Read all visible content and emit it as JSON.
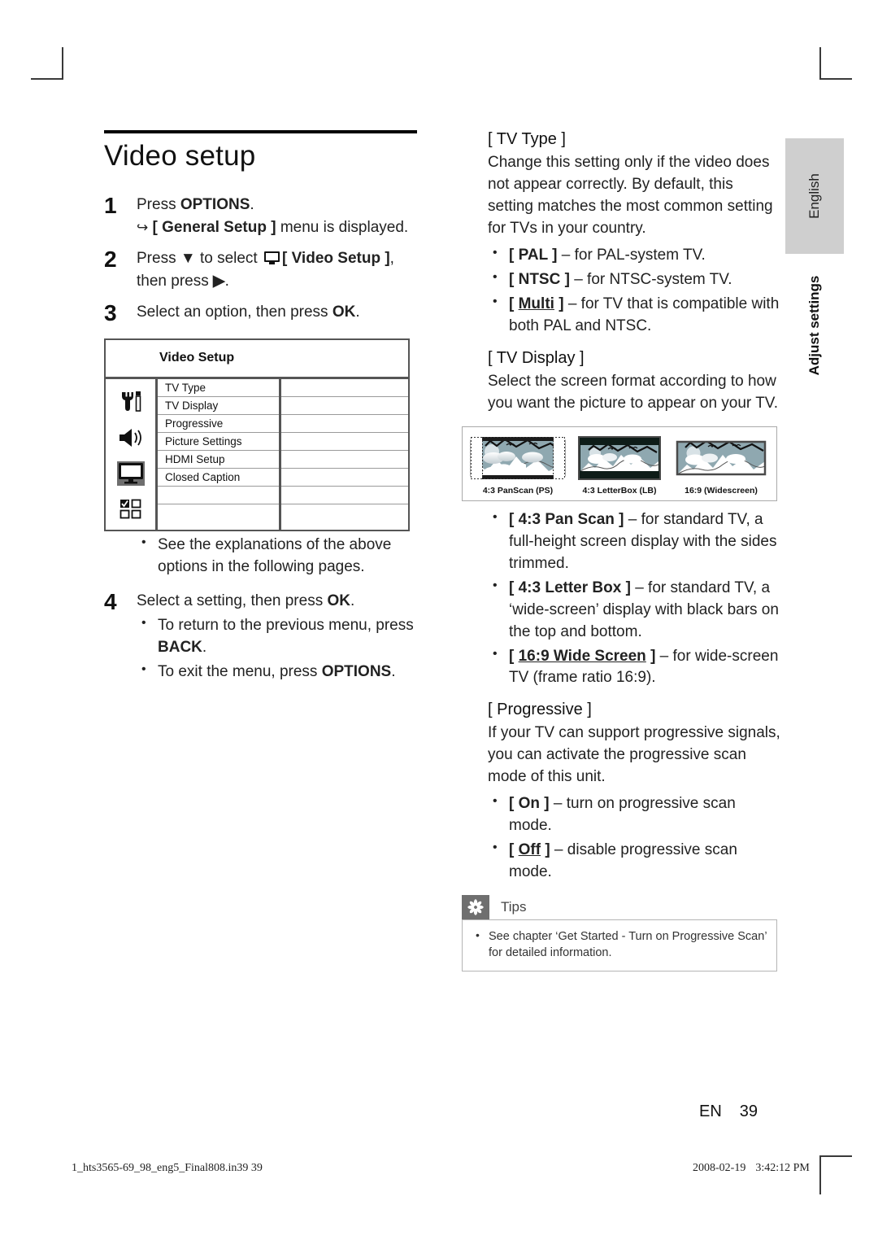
{
  "page": {
    "title": "Video setup",
    "folio_lang": "EN",
    "folio_number": "39",
    "imprint_file": "1_hts3565-69_98_eng5_Final808.in39   39",
    "imprint_date": "2008-02-19",
    "imprint_time": "3:42:12 PM"
  },
  "side_tab": {
    "language": "English",
    "section": "Adjust settings"
  },
  "steps": [
    {
      "num": "1",
      "text": "Press OPTIONS.",
      "lead": "Press ",
      "bold": "OPTIONS",
      "tail": ".",
      "result": "[ General Setup ] menu is displayed.",
      "result_bold": "[ General Setup ]",
      "result_tail": " menu is displayed."
    },
    {
      "num": "2",
      "part1": "Press ",
      "arrow_down": "▼",
      "part2": " to select ",
      "bold": "[ Video Setup ]",
      "part3": ", then press ",
      "arrow_right": "▶",
      "part4": "."
    },
    {
      "num": "3",
      "pre": "Select an option, then press ",
      "bold": "OK",
      "post": "."
    },
    {
      "num": "4",
      "pre": "Select a setting, then press ",
      "bold": "OK",
      "post": "."
    }
  ],
  "step3_bullets": [
    {
      "text": "See the explanations of the above options in the following pages."
    }
  ],
  "step4_bullets": [
    {
      "pre": "To return to the previous menu, press ",
      "bold": "BACK",
      "post": "."
    },
    {
      "pre": "To exit the menu, press ",
      "bold": "OPTIONS",
      "post": "."
    }
  ],
  "video_setup_menu": {
    "title": "Video Setup",
    "icons": [
      {
        "name": "general-setup-tools-icon",
        "selected": false
      },
      {
        "name": "audio-setup-speaker-icon",
        "selected": false
      },
      {
        "name": "video-setup-tv-icon",
        "selected": true
      },
      {
        "name": "preference-setup-checkbox-icon",
        "selected": false
      }
    ],
    "rows": [
      "TV Type",
      "TV Display",
      "Progressive",
      "Picture Settings",
      "HDMI Setup",
      "Closed Caption",
      "",
      ""
    ]
  },
  "tv_type": {
    "heading": "[ TV Type ]",
    "body": "Change this setting only if the video does not appear correctly.  By default, this setting matches the most common setting for TVs in your country.",
    "options": [
      {
        "label": "[ PAL ]",
        "underline": false,
        "desc": " – for PAL-system TV."
      },
      {
        "label": "[ NTSC ]",
        "underline": false,
        "desc": " – for NTSC-system TV."
      },
      {
        "label": "[ Multi ]",
        "underline": true,
        "desc": " – for TV that is compatible with both PAL and NTSC."
      }
    ]
  },
  "tv_display": {
    "heading": "[ TV Display ]",
    "body": "Select the screen format according to how you want the picture to appear on your TV.",
    "figure": {
      "cells": [
        {
          "caption": "4:3 PanScan (PS)",
          "mode": "panscan"
        },
        {
          "caption": "4:3 LetterBox (LB)",
          "mode": "letterbox"
        },
        {
          "caption": "16:9 (Widescreen)",
          "mode": "widescreen"
        }
      ],
      "sky_color": "#8fa8b0",
      "frame_color": "#4a4a4a"
    },
    "options": [
      {
        "label": "[ 4:3 Pan Scan ]",
        "underline": false,
        "desc": " – for standard TV, a full-height screen display with the sides trimmed."
      },
      {
        "label": "[ 4:3 Letter Box ]",
        "underline": false,
        "desc": " – for standard TV,  a ‘wide-screen’ display with black bars on the top and bottom."
      },
      {
        "label": "[ 16:9 Wide Screen ]",
        "underline": true,
        "desc": " – for wide-screen TV (frame ratio 16:9)."
      }
    ]
  },
  "progressive": {
    "heading": "[ Progressive ]",
    "body": "If your TV can support progressive signals, you can activate the progressive scan mode of this unit.",
    "options": [
      {
        "label": "[ On ]",
        "underline": false,
        "desc": " – turn on progressive scan mode."
      },
      {
        "label": "[ Off ]",
        "underline": true,
        "desc": " – disable progressive scan mode."
      }
    ]
  },
  "tips": {
    "label": "Tips",
    "items": [
      "See chapter ‘Get Started - Turn on Progressive Scan’ for detailed information."
    ]
  }
}
